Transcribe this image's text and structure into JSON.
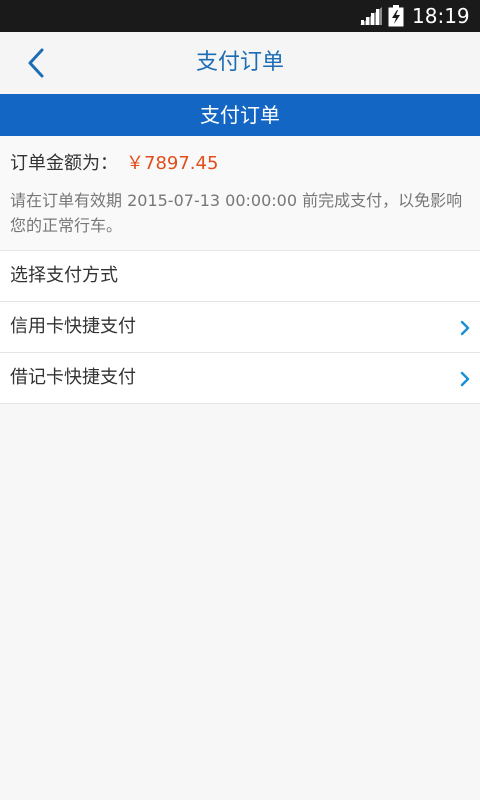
{
  "status_bar": {
    "time": "18:19",
    "signal_icon": "signal-icon",
    "battery_icon": "battery-charging-icon"
  },
  "nav": {
    "back_icon": "chevron-left-icon",
    "title": "支付订单"
  },
  "header": {
    "title": "支付订单"
  },
  "order": {
    "amount_label": "订单金额为：",
    "amount_value": "￥7897.45",
    "note": "请在订单有效期 2015-07-13 00:00:00 前完成支付，以免影响您的正常行车。"
  },
  "payment": {
    "section_label": "选择支付方式",
    "methods": [
      {
        "label": "信用卡快捷支付",
        "icon": "chevron-right-icon"
      },
      {
        "label": "借记卡快捷支付",
        "icon": "chevron-right-icon"
      }
    ]
  },
  "colors": {
    "header_blue": "#1466c4",
    "title_blue": "#1c6db3",
    "amount_orange": "#e14d1b",
    "chevron_blue": "#1a8fd6"
  }
}
